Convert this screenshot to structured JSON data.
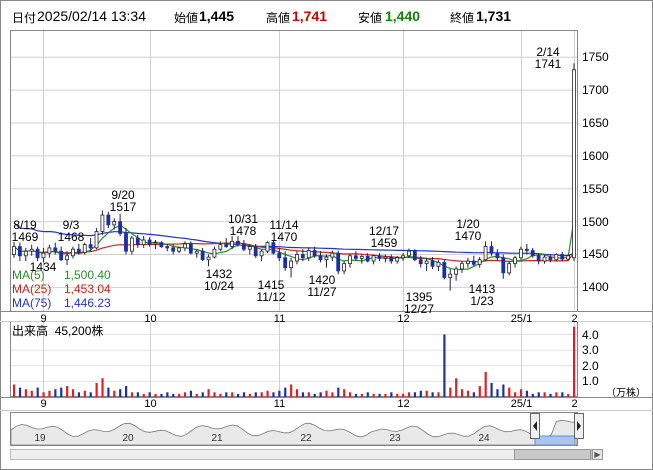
{
  "header": {
    "date_label": "日付",
    "date_value": "2025/02/14 13:34",
    "open_label": "始値",
    "open_value": "1,445",
    "high_label": "高値",
    "high_value": "1,741",
    "low_label": "安値",
    "low_value": "1,440",
    "close_label": "終値",
    "close_value": "1,731"
  },
  "ma": [
    {
      "label": "MA(5)",
      "value": "1,500.40",
      "color": "#2a8c2a"
    },
    {
      "label": "MA(25)",
      "value": "1,453.04",
      "color": "#cc2222"
    },
    {
      "label": "MA(75)",
      "value": "1,446.23",
      "color": "#2233cc"
    }
  ],
  "colors": {
    "up": "#ffffff",
    "down": "#1a2fa8",
    "grid": "#d0d0d0",
    "vol_up": "#e02020",
    "vol_down": "#1a2fa8"
  },
  "annotations": [
    {
      "text": "8/19\n1469"
    },
    {
      "text": "9/3\n1468"
    },
    {
      "text": "1434"
    },
    {
      "text": "9/20\n1517"
    },
    {
      "text": "10/31\n1478"
    },
    {
      "text": "11/14\n1470"
    },
    {
      "text": "1432\n10/24"
    },
    {
      "text": "1415\n11/12"
    },
    {
      "text": "1420\n11/27"
    },
    {
      "text": "12/17\n1459"
    },
    {
      "text": "1395\n12/27"
    },
    {
      "text": "1/20\n1470"
    },
    {
      "text": "1413\n1/23"
    },
    {
      "text": "2/14\n1741"
    }
  ],
  "volume": {
    "label": "出来高",
    "value": "45,200株",
    "unit": "（万株）"
  },
  "navigator_labels": [
    "19",
    "20",
    "21",
    "22",
    "23",
    "24"
  ],
  "chart_data": {
    "type": "candlestick",
    "x_ticks": [
      "9",
      "10",
      "11",
      "12",
      "25/1",
      "2"
    ],
    "y_ticks": [
      1400,
      1450,
      1500,
      1550,
      1600,
      1650,
      1700,
      1750
    ],
    "ylim": [
      1364,
      1790
    ],
    "volume_ticks": [
      "1.0",
      "2.0",
      "3.0",
      "4.0"
    ],
    "volume_ylim": [
      0,
      4.8
    ],
    "days": [
      {
        "o": 1450,
        "h": 1469,
        "l": 1445,
        "c": 1462,
        "v": 0.8
      },
      {
        "o": 1462,
        "h": 1468,
        "l": 1440,
        "c": 1448,
        "v": 0.6
      },
      {
        "o": 1448,
        "h": 1460,
        "l": 1440,
        "c": 1455,
        "v": 0.5
      },
      {
        "o": 1455,
        "h": 1465,
        "l": 1448,
        "c": 1458,
        "v": 0.4
      },
      {
        "o": 1458,
        "h": 1462,
        "l": 1440,
        "c": 1445,
        "v": 0.6
      },
      {
        "o": 1445,
        "h": 1460,
        "l": 1438,
        "c": 1452,
        "v": 0.3
      },
      {
        "o": 1452,
        "h": 1465,
        "l": 1445,
        "c": 1460,
        "v": 0.4
      },
      {
        "o": 1460,
        "h": 1468,
        "l": 1450,
        "c": 1455,
        "v": 0.5
      },
      {
        "o": 1455,
        "h": 1462,
        "l": 1440,
        "c": 1442,
        "v": 0.6
      },
      {
        "o": 1442,
        "h": 1455,
        "l": 1434,
        "c": 1448,
        "v": 0.7
      },
      {
        "o": 1448,
        "h": 1462,
        "l": 1444,
        "c": 1458,
        "v": 0.5
      },
      {
        "o": 1458,
        "h": 1466,
        "l": 1450,
        "c": 1453,
        "v": 0.3
      },
      {
        "o": 1453,
        "h": 1468,
        "l": 1450,
        "c": 1465,
        "v": 0.4
      },
      {
        "o": 1465,
        "h": 1475,
        "l": 1455,
        "c": 1460,
        "v": 0.3
      },
      {
        "o": 1460,
        "h": 1490,
        "l": 1458,
        "c": 1485,
        "v": 0.9
      },
      {
        "o": 1485,
        "h": 1517,
        "l": 1480,
        "c": 1510,
        "v": 1.2
      },
      {
        "o": 1510,
        "h": 1515,
        "l": 1490,
        "c": 1495,
        "v": 0.6
      },
      {
        "o": 1495,
        "h": 1505,
        "l": 1488,
        "c": 1500,
        "v": 0.4
      },
      {
        "o": 1500,
        "h": 1512,
        "l": 1478,
        "c": 1482,
        "v": 0.5
      },
      {
        "o": 1482,
        "h": 1490,
        "l": 1450,
        "c": 1455,
        "v": 0.7
      },
      {
        "o": 1455,
        "h": 1478,
        "l": 1450,
        "c": 1475,
        "v": 0.3
      },
      {
        "o": 1475,
        "h": 1480,
        "l": 1460,
        "c": 1465,
        "v": 0.3
      },
      {
        "o": 1465,
        "h": 1478,
        "l": 1460,
        "c": 1472,
        "v": 0.2
      },
      {
        "o": 1472,
        "h": 1476,
        "l": 1462,
        "c": 1466,
        "v": 0.3
      },
      {
        "o": 1466,
        "h": 1472,
        "l": 1458,
        "c": 1468,
        "v": 0.2
      },
      {
        "o": 1468,
        "h": 1470,
        "l": 1460,
        "c": 1462,
        "v": 0.2
      },
      {
        "o": 1462,
        "h": 1466,
        "l": 1455,
        "c": 1460,
        "v": 0.3
      },
      {
        "o": 1460,
        "h": 1465,
        "l": 1450,
        "c": 1455,
        "v": 0.2
      },
      {
        "o": 1455,
        "h": 1462,
        "l": 1452,
        "c": 1460,
        "v": 0.2
      },
      {
        "o": 1460,
        "h": 1470,
        "l": 1455,
        "c": 1466,
        "v": 0.3
      },
      {
        "o": 1466,
        "h": 1470,
        "l": 1450,
        "c": 1452,
        "v": 0.4
      },
      {
        "o": 1452,
        "h": 1458,
        "l": 1445,
        "c": 1455,
        "v": 0.2
      },
      {
        "o": 1455,
        "h": 1460,
        "l": 1440,
        "c": 1442,
        "v": 0.3
      },
      {
        "o": 1442,
        "h": 1450,
        "l": 1432,
        "c": 1446,
        "v": 0.5
      },
      {
        "o": 1446,
        "h": 1462,
        "l": 1444,
        "c": 1458,
        "v": 0.3
      },
      {
        "o": 1458,
        "h": 1470,
        "l": 1455,
        "c": 1465,
        "v": 0.2
      },
      {
        "o": 1465,
        "h": 1475,
        "l": 1460,
        "c": 1462,
        "v": 0.3
      },
      {
        "o": 1462,
        "h": 1478,
        "l": 1458,
        "c": 1470,
        "v": 0.3
      },
      {
        "o": 1470,
        "h": 1478,
        "l": 1462,
        "c": 1466,
        "v": 0.2
      },
      {
        "o": 1466,
        "h": 1472,
        "l": 1455,
        "c": 1458,
        "v": 0.3
      },
      {
        "o": 1458,
        "h": 1466,
        "l": 1450,
        "c": 1462,
        "v": 0.2
      },
      {
        "o": 1462,
        "h": 1466,
        "l": 1445,
        "c": 1448,
        "v": 0.3
      },
      {
        "o": 1448,
        "h": 1458,
        "l": 1440,
        "c": 1455,
        "v": 0.3
      },
      {
        "o": 1455,
        "h": 1470,
        "l": 1452,
        "c": 1468,
        "v": 0.4
      },
      {
        "o": 1468,
        "h": 1472,
        "l": 1450,
        "c": 1452,
        "v": 0.3
      },
      {
        "o": 1452,
        "h": 1460,
        "l": 1440,
        "c": 1445,
        "v": 0.4
      },
      {
        "o": 1445,
        "h": 1455,
        "l": 1425,
        "c": 1430,
        "v": 0.6
      },
      {
        "o": 1430,
        "h": 1445,
        "l": 1415,
        "c": 1440,
        "v": 0.8
      },
      {
        "o": 1440,
        "h": 1455,
        "l": 1435,
        "c": 1450,
        "v": 0.5
      },
      {
        "o": 1450,
        "h": 1458,
        "l": 1440,
        "c": 1445,
        "v": 0.3
      },
      {
        "o": 1445,
        "h": 1460,
        "l": 1440,
        "c": 1456,
        "v": 0.3
      },
      {
        "o": 1456,
        "h": 1462,
        "l": 1445,
        "c": 1448,
        "v": 0.2
      },
      {
        "o": 1448,
        "h": 1455,
        "l": 1438,
        "c": 1442,
        "v": 0.3
      },
      {
        "o": 1442,
        "h": 1450,
        "l": 1430,
        "c": 1446,
        "v": 0.4
      },
      {
        "o": 1446,
        "h": 1456,
        "l": 1440,
        "c": 1452,
        "v": 0.3
      },
      {
        "o": 1452,
        "h": 1456,
        "l": 1420,
        "c": 1425,
        "v": 0.6
      },
      {
        "o": 1425,
        "h": 1440,
        "l": 1420,
        "c": 1436,
        "v": 0.5
      },
      {
        "o": 1436,
        "h": 1450,
        "l": 1430,
        "c": 1448,
        "v": 0.3
      },
      {
        "o": 1448,
        "h": 1455,
        "l": 1440,
        "c": 1444,
        "v": 0.2
      },
      {
        "o": 1444,
        "h": 1450,
        "l": 1436,
        "c": 1447,
        "v": 0.2
      },
      {
        "o": 1447,
        "h": 1452,
        "l": 1438,
        "c": 1440,
        "v": 0.3
      },
      {
        "o": 1440,
        "h": 1450,
        "l": 1435,
        "c": 1448,
        "v": 0.2
      },
      {
        "o": 1448,
        "h": 1452,
        "l": 1440,
        "c": 1444,
        "v": 0.2
      },
      {
        "o": 1444,
        "h": 1450,
        "l": 1438,
        "c": 1446,
        "v": 0.2
      },
      {
        "o": 1446,
        "h": 1450,
        "l": 1436,
        "c": 1440,
        "v": 0.3
      },
      {
        "o": 1440,
        "h": 1448,
        "l": 1436,
        "c": 1445,
        "v": 0.2
      },
      {
        "o": 1445,
        "h": 1452,
        "l": 1440,
        "c": 1448,
        "v": 0.2
      },
      {
        "o": 1448,
        "h": 1459,
        "l": 1445,
        "c": 1455,
        "v": 0.3
      },
      {
        "o": 1455,
        "h": 1458,
        "l": 1440,
        "c": 1442,
        "v": 0.3
      },
      {
        "o": 1442,
        "h": 1448,
        "l": 1430,
        "c": 1436,
        "v": 0.4
      },
      {
        "o": 1436,
        "h": 1445,
        "l": 1425,
        "c": 1440,
        "v": 0.4
      },
      {
        "o": 1440,
        "h": 1446,
        "l": 1428,
        "c": 1432,
        "v": 0.3
      },
      {
        "o": 1432,
        "h": 1442,
        "l": 1425,
        "c": 1438,
        "v": 0.3
      },
      {
        "o": 1438,
        "h": 1442,
        "l": 1412,
        "c": 1415,
        "v": 4.0
      },
      {
        "o": 1415,
        "h": 1428,
        "l": 1395,
        "c": 1420,
        "v": 0.6
      },
      {
        "o": 1420,
        "h": 1432,
        "l": 1410,
        "c": 1428,
        "v": 1.2
      },
      {
        "o": 1428,
        "h": 1440,
        "l": 1422,
        "c": 1436,
        "v": 0.5
      },
      {
        "o": 1436,
        "h": 1445,
        "l": 1430,
        "c": 1440,
        "v": 0.4
      },
      {
        "o": 1440,
        "h": 1448,
        "l": 1432,
        "c": 1435,
        "v": 0.3
      },
      {
        "o": 1435,
        "h": 1446,
        "l": 1430,
        "c": 1442,
        "v": 0.7
      },
      {
        "o": 1442,
        "h": 1470,
        "l": 1440,
        "c": 1462,
        "v": 1.6
      },
      {
        "o": 1462,
        "h": 1470,
        "l": 1448,
        "c": 1452,
        "v": 0.9
      },
      {
        "o": 1452,
        "h": 1458,
        "l": 1440,
        "c": 1445,
        "v": 0.5
      },
      {
        "o": 1445,
        "h": 1450,
        "l": 1413,
        "c": 1422,
        "v": 0.8
      },
      {
        "o": 1422,
        "h": 1440,
        "l": 1418,
        "c": 1436,
        "v": 0.6
      },
      {
        "o": 1436,
        "h": 1448,
        "l": 1430,
        "c": 1445,
        "v": 0.3
      },
      {
        "o": 1445,
        "h": 1462,
        "l": 1442,
        "c": 1458,
        "v": 0.5
      },
      {
        "o": 1458,
        "h": 1466,
        "l": 1450,
        "c": 1456,
        "v": 0.4
      },
      {
        "o": 1456,
        "h": 1460,
        "l": 1445,
        "c": 1448,
        "v": 0.2
      },
      {
        "o": 1448,
        "h": 1452,
        "l": 1435,
        "c": 1440,
        "v": 0.3
      },
      {
        "o": 1440,
        "h": 1450,
        "l": 1436,
        "c": 1446,
        "v": 0.3
      },
      {
        "o": 1446,
        "h": 1450,
        "l": 1438,
        "c": 1442,
        "v": 0.2
      },
      {
        "o": 1442,
        "h": 1452,
        "l": 1440,
        "c": 1450,
        "v": 0.3
      },
      {
        "o": 1450,
        "h": 1454,
        "l": 1440,
        "c": 1443,
        "v": 0.3
      },
      {
        "o": 1443,
        "h": 1450,
        "l": 1440,
        "c": 1448,
        "v": 0.2
      },
      {
        "o": 1445,
        "h": 1741,
        "l": 1440,
        "c": 1731,
        "v": 4.5
      }
    ]
  }
}
